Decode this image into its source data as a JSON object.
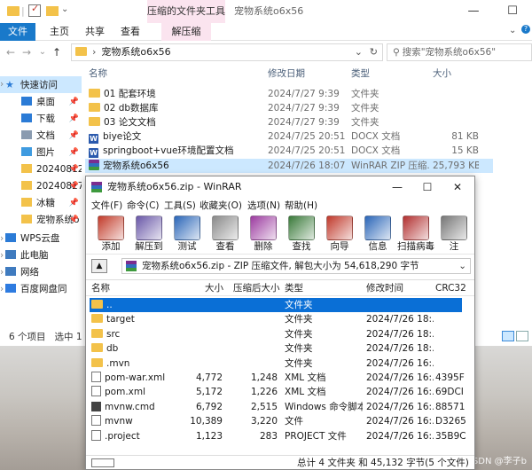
{
  "explorer": {
    "title": "宠物系统o6x56",
    "context_tab_title": "压缩的文件夹工具",
    "ribbon_tabs": [
      "文件",
      "主页",
      "共享",
      "查看",
      "解压缩"
    ],
    "address": "宠物系统o6x56",
    "search_placeholder": "搜索\"宠物系统o6x56\"",
    "window_controls": {
      "minimize": "—",
      "maximize": "☐",
      "close": "✕"
    },
    "nav": {
      "back": "←",
      "forward": "→",
      "dropdown": "⌄",
      "up": "↑"
    },
    "nav_items": [
      {
        "label": "快速访问",
        "icon": "star-icon",
        "selected": true
      },
      {
        "label": "桌面",
        "icon": "desktop-icon"
      },
      {
        "label": "下载",
        "icon": "download-icon"
      },
      {
        "label": "文档",
        "icon": "document-icon"
      },
      {
        "label": "图片",
        "icon": "picture-icon"
      },
      {
        "label": "20240812",
        "icon": "folder-icon"
      },
      {
        "label": "20240827",
        "icon": "folder-icon"
      },
      {
        "label": "冰糖",
        "icon": "folder-icon"
      },
      {
        "label": "宠物系统o",
        "icon": "folder-icon"
      },
      {
        "label": "WPS云盘",
        "icon": "cloud-icon"
      },
      {
        "label": "此电脑",
        "icon": "computer-icon"
      },
      {
        "label": "网络",
        "icon": "network-icon"
      },
      {
        "label": "百度网盘同",
        "icon": "baidu-icon"
      }
    ],
    "columns": [
      "名称",
      "修改日期",
      "类型",
      "大小"
    ],
    "files": [
      {
        "name": "01 配套环境",
        "date": "2024/7/27 9:39",
        "type": "文件夹",
        "size": "",
        "kind": "folder"
      },
      {
        "name": "02 db数据库",
        "date": "2024/7/27 9:39",
        "type": "文件夹",
        "size": "",
        "kind": "folder"
      },
      {
        "name": "03 论文文档",
        "date": "2024/7/27 9:39",
        "type": "文件夹",
        "size": "",
        "kind": "folder"
      },
      {
        "name": "biye论文",
        "date": "2024/7/25 20:51",
        "type": "DOCX 文档",
        "size": "81 KB",
        "kind": "docx"
      },
      {
        "name": "springboot+vue环境配置文档",
        "date": "2024/7/25 20:51",
        "type": "DOCX 文档",
        "size": "15 KB",
        "kind": "docx"
      },
      {
        "name": "宠物系统o6x56",
        "date": "2024/7/26 18:07",
        "type": "WinRAR ZIP 压缩...",
        "size": "25,793 KB",
        "kind": "rar",
        "selected": true
      }
    ],
    "status_count": "6 个项目",
    "status_selected": "选中 1",
    "watermark": "CSDN @李子b"
  },
  "winrar": {
    "title": "宠物系统o6x56.zip - WinRAR",
    "window_controls": {
      "minimize": "—",
      "maximize": "☐",
      "close": "✕"
    },
    "menu": [
      "文件(F)",
      "命令(C)",
      "工具(S)",
      "收藏夹(O)",
      "选项(N)",
      "帮助(H)"
    ],
    "toolbar": [
      {
        "label": "添加",
        "icon": "add-icon",
        "color": "#c23b2a"
      },
      {
        "label": "解压到",
        "icon": "extract-icon",
        "color": "#6a58a8"
      },
      {
        "label": "测试",
        "icon": "test-icon",
        "color": "#2b66b8"
      },
      {
        "label": "查看",
        "icon": "view-icon",
        "color": "#8a8a8a"
      },
      {
        "label": "删除",
        "icon": "delete-icon",
        "color": "#9c3ca0"
      },
      {
        "label": "查找",
        "icon": "find-icon",
        "color": "#3a7a3a"
      },
      {
        "label": "向导",
        "icon": "wizard-icon",
        "color": "#c0392b"
      },
      {
        "label": "信息",
        "icon": "info-icon",
        "color": "#2b66b8"
      },
      {
        "label": "扫描病毒",
        "icon": "virus-scan-icon",
        "color": "#b23030"
      },
      {
        "label": "注",
        "icon": "comment-icon",
        "color": "#777777"
      }
    ],
    "path_text": "宠物系统o6x56.zip - ZIP 压缩文件, 解包大小为 54,618,290 字节",
    "columns": [
      "名称",
      "大小",
      "压缩后大小",
      "类型",
      "修改时间",
      "CRC32"
    ],
    "rows": [
      {
        "name": "..",
        "size": "",
        "packed": "",
        "type": "文件夹",
        "mtime": "",
        "crc": "",
        "kind": "folder",
        "selected": true
      },
      {
        "name": "target",
        "size": "",
        "packed": "",
        "type": "文件夹",
        "mtime": "2024/7/26 18:...",
        "crc": "",
        "kind": "folder"
      },
      {
        "name": "src",
        "size": "",
        "packed": "",
        "type": "文件夹",
        "mtime": "2024/7/26 18:...",
        "crc": "",
        "kind": "folder"
      },
      {
        "name": "db",
        "size": "",
        "packed": "",
        "type": "文件夹",
        "mtime": "2024/7/26 18:...",
        "crc": "",
        "kind": "folder"
      },
      {
        "name": ".mvn",
        "size": "",
        "packed": "",
        "type": "文件夹",
        "mtime": "2024/7/26 16:...",
        "crc": "",
        "kind": "folder"
      },
      {
        "name": "pom-war.xml",
        "size": "4,772",
        "packed": "1,248",
        "type": "XML 文档",
        "mtime": "2024/7/26 16:...",
        "crc": "4395F",
        "kind": "xml"
      },
      {
        "name": "pom.xml",
        "size": "5,172",
        "packed": "1,226",
        "type": "XML 文档",
        "mtime": "2024/7/26 16:...",
        "crc": "69DCI",
        "kind": "xml"
      },
      {
        "name": "mvnw.cmd",
        "size": "6,792",
        "packed": "2,515",
        "type": "Windows 命令脚本",
        "mtime": "2024/7/26 16:...",
        "crc": "88571",
        "kind": "cmd"
      },
      {
        "name": "mvnw",
        "size": "10,389",
        "packed": "3,220",
        "type": "文件",
        "mtime": "2024/7/26 16:...",
        "crc": "D3265",
        "kind": "file"
      },
      {
        "name": ".project",
        "size": "1,123",
        "packed": "283",
        "type": "PROJECT 文件",
        "mtime": "2024/7/26 16:...",
        "crc": "35B9C",
        "kind": "file"
      }
    ],
    "status": "总计 4 文件夹 和 45,132 字节(5 个文件)"
  }
}
